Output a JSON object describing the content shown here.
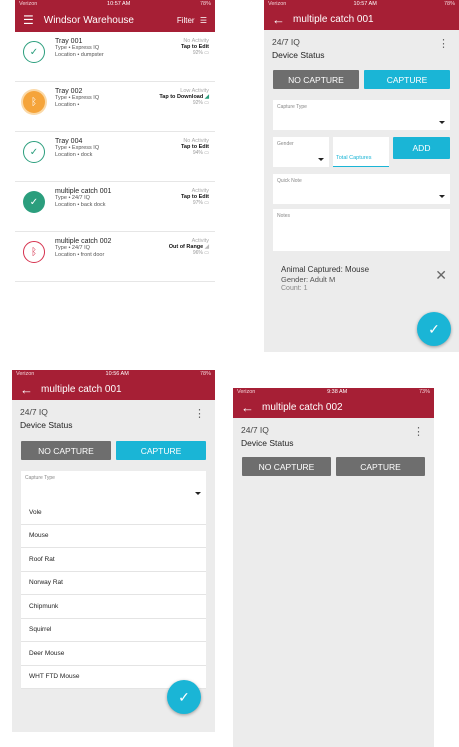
{
  "screen1": {
    "status": {
      "left": "Verizon",
      "time": "10:57 AM",
      "right": "78%"
    },
    "title": "Windsor Warehouse",
    "filter_label": "Filter",
    "rows": [
      {
        "name": "Tray 001",
        "type": "Type • Express IQ",
        "location": "Location • dumpster",
        "status": "No Activity",
        "action": "Tap to Edit",
        "battery": "92%"
      },
      {
        "name": "Tray 002",
        "type": "Type • Express IQ",
        "location": "Location •",
        "status": "Low Activity",
        "action": "Tap to Download",
        "battery": "92%"
      },
      {
        "name": "Tray 004",
        "type": "Type • Express IQ",
        "location": "Location • dock",
        "status": "No Activity",
        "action": "Tap to Edit",
        "battery": "94%"
      },
      {
        "name": "multiple catch 001",
        "type": "Type • 24/7 IQ",
        "location": "Location • back dock",
        "status": "Activity",
        "action": "Tap to Edit",
        "battery": "97%"
      },
      {
        "name": "multiple catch 002",
        "type": "Type • 24/7 IQ",
        "location": "Location • front door",
        "status": "Activity",
        "action": "Out of Range",
        "battery": "96%"
      }
    ]
  },
  "screen2": {
    "status": {
      "left": "Verizon",
      "time": "10:57 AM",
      "right": "78%"
    },
    "title": "multiple catch 001",
    "iq": "24/7 IQ",
    "device_status": "Device Status",
    "no_capture": "NO CAPTURE",
    "capture": "CAPTURE",
    "capture_type_label": "Capture Type",
    "gender_label": "Gender",
    "total_captures_placeholder": "Total Captures",
    "add": "ADD",
    "quick_note_label": "Quick Note",
    "notes_label": "Notes",
    "summary": {
      "animal": "Animal Captured: Mouse",
      "gender": "Gender: Adult M",
      "count": "Count: 1"
    }
  },
  "screen3": {
    "status": {
      "left": "Verizon",
      "time": "10:56 AM",
      "right": "78%"
    },
    "title": "multiple catch 001",
    "iq": "24/7 IQ",
    "device_status": "Device Status",
    "no_capture": "NO CAPTURE",
    "capture": "CAPTURE",
    "capture_type_label": "Capture Type",
    "options": [
      "Vole",
      "Mouse",
      "Roof Rat",
      "Norway Rat",
      "Chipmunk",
      "Squirrel",
      "Deer Mouse",
      "WHT FTD Mouse"
    ]
  },
  "screen4": {
    "status": {
      "left": "Verizon",
      "time": "9:38 AM",
      "right": "73%"
    },
    "title": "multiple catch 002",
    "iq": "24/7 IQ",
    "device_status": "Device Status",
    "no_capture": "NO CAPTURE",
    "capture": "CAPTURE"
  },
  "colors": {
    "brand": "#a61f35",
    "accent": "#1ab5d6",
    "ok": "#2b9e7d",
    "warn": "#f5a43a",
    "error": "#d6334f"
  },
  "icons": [
    "menu-icon",
    "filter-icon",
    "check-icon",
    "bluetooth-icon",
    "back-arrow-icon",
    "kebab-menu-icon",
    "close-icon",
    "battery-icon"
  ]
}
